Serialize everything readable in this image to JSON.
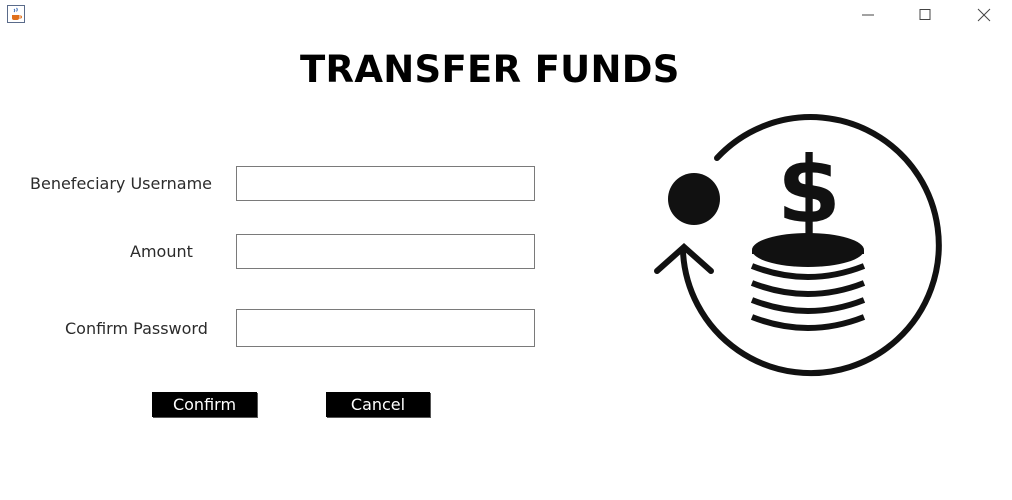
{
  "window": {
    "title": "",
    "icons": {
      "app": "java-cup-icon",
      "minimize": "minimize-icon",
      "maximize": "maximize-icon",
      "close": "close-icon"
    }
  },
  "form": {
    "title": "TRANSFER FUNDS",
    "fields": [
      {
        "label": "Benefeciary Username",
        "value": "",
        "placeholder": ""
      },
      {
        "label": "Amount",
        "value": "",
        "placeholder": ""
      },
      {
        "label": "Confirm Password",
        "value": "",
        "placeholder": ""
      }
    ],
    "buttons": {
      "confirm": "Confirm",
      "cancel": "Cancel"
    }
  },
  "illustration": {
    "icon": "money-transfer-icon",
    "color": "#111111"
  }
}
